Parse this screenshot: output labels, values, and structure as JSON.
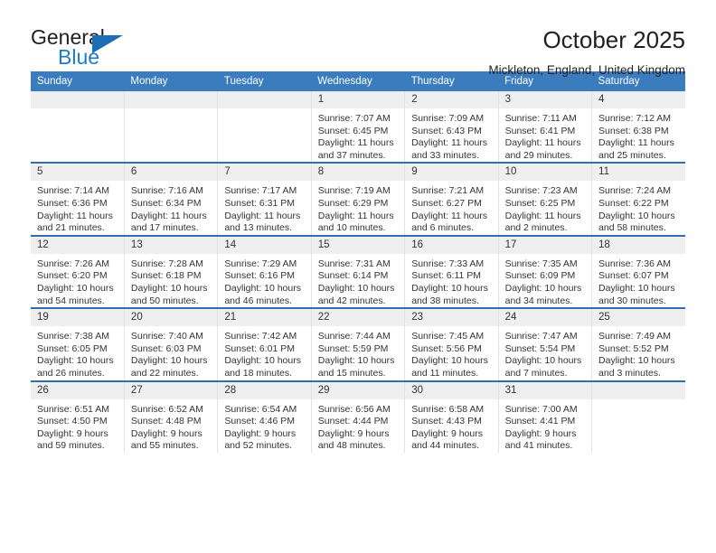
{
  "brand": {
    "name_part1": "General",
    "name_part2": "Blue",
    "triangle_icon": "triangle-icon",
    "accent_color": "#1c7cc7"
  },
  "header": {
    "title": "October 2025",
    "location": "Mickleton, England, United Kingdom"
  },
  "theme": {
    "header_row_bg": "#3b7cbf",
    "row_divider": "#2f6fb0",
    "daynum_bg": "#efefef",
    "text": "#333333"
  },
  "weekday_headers": [
    "Sunday",
    "Monday",
    "Tuesday",
    "Wednesday",
    "Thursday",
    "Friday",
    "Saturday"
  ],
  "labels": {
    "sunrise": "Sunrise:",
    "sunset": "Sunset:",
    "daylight": "Daylight:"
  },
  "weeks": [
    [
      {
        "day": "",
        "sunrise": "",
        "sunset": "",
        "daylight_line1": "",
        "daylight_line2": ""
      },
      {
        "day": "",
        "sunrise": "",
        "sunset": "",
        "daylight_line1": "",
        "daylight_line2": ""
      },
      {
        "day": "",
        "sunrise": "",
        "sunset": "",
        "daylight_line1": "",
        "daylight_line2": ""
      },
      {
        "day": "1",
        "sunrise": "Sunrise: 7:07 AM",
        "sunset": "Sunset: 6:45 PM",
        "daylight_line1": "Daylight: 11 hours",
        "daylight_line2": "and 37 minutes."
      },
      {
        "day": "2",
        "sunrise": "Sunrise: 7:09 AM",
        "sunset": "Sunset: 6:43 PM",
        "daylight_line1": "Daylight: 11 hours",
        "daylight_line2": "and 33 minutes."
      },
      {
        "day": "3",
        "sunrise": "Sunrise: 7:11 AM",
        "sunset": "Sunset: 6:41 PM",
        "daylight_line1": "Daylight: 11 hours",
        "daylight_line2": "and 29 minutes."
      },
      {
        "day": "4",
        "sunrise": "Sunrise: 7:12 AM",
        "sunset": "Sunset: 6:38 PM",
        "daylight_line1": "Daylight: 11 hours",
        "daylight_line2": "and 25 minutes."
      }
    ],
    [
      {
        "day": "5",
        "sunrise": "Sunrise: 7:14 AM",
        "sunset": "Sunset: 6:36 PM",
        "daylight_line1": "Daylight: 11 hours",
        "daylight_line2": "and 21 minutes."
      },
      {
        "day": "6",
        "sunrise": "Sunrise: 7:16 AM",
        "sunset": "Sunset: 6:34 PM",
        "daylight_line1": "Daylight: 11 hours",
        "daylight_line2": "and 17 minutes."
      },
      {
        "day": "7",
        "sunrise": "Sunrise: 7:17 AM",
        "sunset": "Sunset: 6:31 PM",
        "daylight_line1": "Daylight: 11 hours",
        "daylight_line2": "and 13 minutes."
      },
      {
        "day": "8",
        "sunrise": "Sunrise: 7:19 AM",
        "sunset": "Sunset: 6:29 PM",
        "daylight_line1": "Daylight: 11 hours",
        "daylight_line2": "and 10 minutes."
      },
      {
        "day": "9",
        "sunrise": "Sunrise: 7:21 AM",
        "sunset": "Sunset: 6:27 PM",
        "daylight_line1": "Daylight: 11 hours",
        "daylight_line2": "and 6 minutes."
      },
      {
        "day": "10",
        "sunrise": "Sunrise: 7:23 AM",
        "sunset": "Sunset: 6:25 PM",
        "daylight_line1": "Daylight: 11 hours",
        "daylight_line2": "and 2 minutes."
      },
      {
        "day": "11",
        "sunrise": "Sunrise: 7:24 AM",
        "sunset": "Sunset: 6:22 PM",
        "daylight_line1": "Daylight: 10 hours",
        "daylight_line2": "and 58 minutes."
      }
    ],
    [
      {
        "day": "12",
        "sunrise": "Sunrise: 7:26 AM",
        "sunset": "Sunset: 6:20 PM",
        "daylight_line1": "Daylight: 10 hours",
        "daylight_line2": "and 54 minutes."
      },
      {
        "day": "13",
        "sunrise": "Sunrise: 7:28 AM",
        "sunset": "Sunset: 6:18 PM",
        "daylight_line1": "Daylight: 10 hours",
        "daylight_line2": "and 50 minutes."
      },
      {
        "day": "14",
        "sunrise": "Sunrise: 7:29 AM",
        "sunset": "Sunset: 6:16 PM",
        "daylight_line1": "Daylight: 10 hours",
        "daylight_line2": "and 46 minutes."
      },
      {
        "day": "15",
        "sunrise": "Sunrise: 7:31 AM",
        "sunset": "Sunset: 6:14 PM",
        "daylight_line1": "Daylight: 10 hours",
        "daylight_line2": "and 42 minutes."
      },
      {
        "day": "16",
        "sunrise": "Sunrise: 7:33 AM",
        "sunset": "Sunset: 6:11 PM",
        "daylight_line1": "Daylight: 10 hours",
        "daylight_line2": "and 38 minutes."
      },
      {
        "day": "17",
        "sunrise": "Sunrise: 7:35 AM",
        "sunset": "Sunset: 6:09 PM",
        "daylight_line1": "Daylight: 10 hours",
        "daylight_line2": "and 34 minutes."
      },
      {
        "day": "18",
        "sunrise": "Sunrise: 7:36 AM",
        "sunset": "Sunset: 6:07 PM",
        "daylight_line1": "Daylight: 10 hours",
        "daylight_line2": "and 30 minutes."
      }
    ],
    [
      {
        "day": "19",
        "sunrise": "Sunrise: 7:38 AM",
        "sunset": "Sunset: 6:05 PM",
        "daylight_line1": "Daylight: 10 hours",
        "daylight_line2": "and 26 minutes."
      },
      {
        "day": "20",
        "sunrise": "Sunrise: 7:40 AM",
        "sunset": "Sunset: 6:03 PM",
        "daylight_line1": "Daylight: 10 hours",
        "daylight_line2": "and 22 minutes."
      },
      {
        "day": "21",
        "sunrise": "Sunrise: 7:42 AM",
        "sunset": "Sunset: 6:01 PM",
        "daylight_line1": "Daylight: 10 hours",
        "daylight_line2": "and 18 minutes."
      },
      {
        "day": "22",
        "sunrise": "Sunrise: 7:44 AM",
        "sunset": "Sunset: 5:59 PM",
        "daylight_line1": "Daylight: 10 hours",
        "daylight_line2": "and 15 minutes."
      },
      {
        "day": "23",
        "sunrise": "Sunrise: 7:45 AM",
        "sunset": "Sunset: 5:56 PM",
        "daylight_line1": "Daylight: 10 hours",
        "daylight_line2": "and 11 minutes."
      },
      {
        "day": "24",
        "sunrise": "Sunrise: 7:47 AM",
        "sunset": "Sunset: 5:54 PM",
        "daylight_line1": "Daylight: 10 hours",
        "daylight_line2": "and 7 minutes."
      },
      {
        "day": "25",
        "sunrise": "Sunrise: 7:49 AM",
        "sunset": "Sunset: 5:52 PM",
        "daylight_line1": "Daylight: 10 hours",
        "daylight_line2": "and 3 minutes."
      }
    ],
    [
      {
        "day": "26",
        "sunrise": "Sunrise: 6:51 AM",
        "sunset": "Sunset: 4:50 PM",
        "daylight_line1": "Daylight: 9 hours",
        "daylight_line2": "and 59 minutes."
      },
      {
        "day": "27",
        "sunrise": "Sunrise: 6:52 AM",
        "sunset": "Sunset: 4:48 PM",
        "daylight_line1": "Daylight: 9 hours",
        "daylight_line2": "and 55 minutes."
      },
      {
        "day": "28",
        "sunrise": "Sunrise: 6:54 AM",
        "sunset": "Sunset: 4:46 PM",
        "daylight_line1": "Daylight: 9 hours",
        "daylight_line2": "and 52 minutes."
      },
      {
        "day": "29",
        "sunrise": "Sunrise: 6:56 AM",
        "sunset": "Sunset: 4:44 PM",
        "daylight_line1": "Daylight: 9 hours",
        "daylight_line2": "and 48 minutes."
      },
      {
        "day": "30",
        "sunrise": "Sunrise: 6:58 AM",
        "sunset": "Sunset: 4:43 PM",
        "daylight_line1": "Daylight: 9 hours",
        "daylight_line2": "and 44 minutes."
      },
      {
        "day": "31",
        "sunrise": "Sunrise: 7:00 AM",
        "sunset": "Sunset: 4:41 PM",
        "daylight_line1": "Daylight: 9 hours",
        "daylight_line2": "and 41 minutes."
      },
      {
        "day": "",
        "sunrise": "",
        "sunset": "",
        "daylight_line1": "",
        "daylight_line2": ""
      }
    ]
  ]
}
